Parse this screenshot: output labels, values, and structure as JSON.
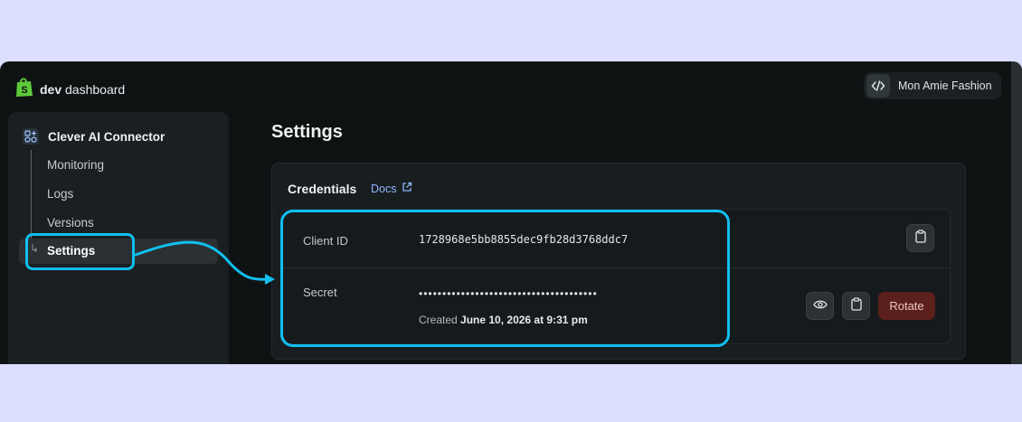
{
  "header": {
    "brand_bold": "dev",
    "brand_rest": " dashboard",
    "store_name": "Mon Amie Fashion"
  },
  "sidebar": {
    "app_name": "Clever AI Connector",
    "items": [
      {
        "label": "Monitoring"
      },
      {
        "label": "Logs"
      },
      {
        "label": "Versions"
      },
      {
        "label": "Settings",
        "active": true
      }
    ]
  },
  "main": {
    "title": "Settings",
    "credentials": {
      "title": "Credentials",
      "docs_label": "Docs",
      "client_id_label": "Client ID",
      "client_id_value": "1728968e5bb8855dec9fb28d3768ddc7",
      "secret_label": "Secret",
      "secret_masked": "••••••••••••••••••••••••••••••••••••••",
      "created_prefix": "Created ",
      "created_date": "June 10, 2026 at 9:31 pm",
      "rotate_label": "Rotate"
    }
  },
  "colors": {
    "highlight": "#11bff0",
    "rotate_bg": "#5b1f1c",
    "link": "#8fb5ff",
    "shopify_green": "#5fc93b"
  },
  "icons": [
    "shopify-bag-icon",
    "code-icon",
    "app-grid-icon",
    "external-link-icon",
    "clipboard-icon",
    "eye-icon"
  ]
}
